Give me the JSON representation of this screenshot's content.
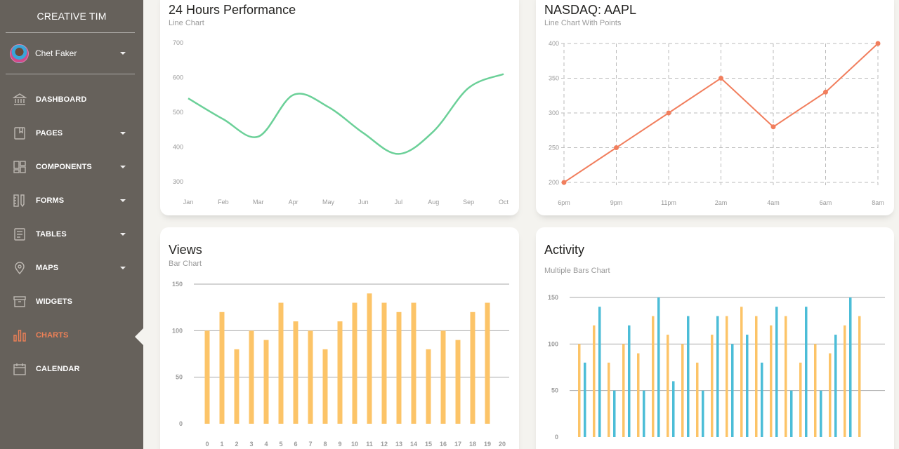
{
  "sidebar": {
    "brand": "CREATIVE TIM",
    "user_name": "Chet Faker",
    "items": [
      {
        "label": "DASHBOARD",
        "icon": "bank-icon",
        "has_caret": false,
        "active": false
      },
      {
        "label": "PAGES",
        "icon": "book-bookmark-icon",
        "has_caret": true,
        "active": false
      },
      {
        "label": "COMPONENTS",
        "icon": "layout-icon",
        "has_caret": true,
        "active": false
      },
      {
        "label": "FORMS",
        "icon": "ruler-pencil-icon",
        "has_caret": true,
        "active": false
      },
      {
        "label": "TABLES",
        "icon": "paper-icon",
        "has_caret": true,
        "active": false
      },
      {
        "label": "MAPS",
        "icon": "pin-icon",
        "has_caret": true,
        "active": false
      },
      {
        "label": "WIDGETS",
        "icon": "box-icon",
        "has_caret": false,
        "active": false
      },
      {
        "label": "CHARTS",
        "icon": "chart-bar-icon",
        "has_caret": false,
        "active": true
      },
      {
        "label": "CALENDAR",
        "icon": "calendar-icon",
        "has_caret": false,
        "active": false
      }
    ]
  },
  "colors": {
    "sidebar_bg": "#66615b",
    "accent": "#ef8157",
    "green": "#6bd098",
    "orange_line": "#f17e5d",
    "yellow": "#fcc468",
    "teal": "#4acccd",
    "blue": "#51bcda"
  },
  "cards": {
    "performance": {
      "title": "24 Hours Performance",
      "subtitle": "Line Chart"
    },
    "nasdaq": {
      "title": "NASDAQ: AAPL",
      "subtitle": "Line Chart With Points"
    },
    "views": {
      "title": "Views",
      "subtitle": "Bar Chart"
    },
    "activity": {
      "title": "Activity",
      "subtitle": "Multiple Bars Chart"
    }
  },
  "chart_data": [
    {
      "id": "performance",
      "type": "line",
      "title": "24 Hours Performance",
      "subtitle": "Line Chart",
      "categories": [
        "Jan",
        "Feb",
        "Mar",
        "Apr",
        "May",
        "Jun",
        "Jul",
        "Aug",
        "Sep",
        "Oct"
      ],
      "values": [
        540,
        480,
        430,
        550,
        515,
        440,
        380,
        445,
        570,
        610
      ],
      "yticks": [
        700,
        600,
        500,
        400,
        300
      ],
      "ylim": [
        300,
        700
      ],
      "grid": false,
      "color": "#6bd098"
    },
    {
      "id": "nasdaq",
      "type": "line",
      "title": "NASDAQ: AAPL",
      "subtitle": "Line Chart With Points",
      "categories": [
        "6pm",
        "9pm",
        "11pm",
        "2am",
        "4am",
        "6am",
        "8am"
      ],
      "values": [
        200,
        250,
        300,
        350,
        280,
        330,
        400
      ],
      "yticks": [
        400,
        350,
        300,
        250,
        200
      ],
      "ylim": [
        200,
        400
      ],
      "grid": true,
      "grid_style": "dashed",
      "color": "#f17e5d"
    },
    {
      "id": "views",
      "type": "bar",
      "title": "Views",
      "subtitle": "Bar Chart",
      "categories": [
        "0",
        "1",
        "2",
        "3",
        "4",
        "5",
        "6",
        "7",
        "8",
        "9",
        "10",
        "11",
        "12",
        "13",
        "14",
        "15",
        "16",
        "17",
        "18",
        "19",
        "20"
      ],
      "values": [
        100,
        120,
        80,
        100,
        90,
        130,
        110,
        100,
        80,
        110,
        130,
        140,
        130,
        120,
        130,
        80,
        100,
        90,
        120,
        130
      ],
      "yticks": [
        150,
        100,
        50,
        0
      ],
      "ylim": [
        0,
        150
      ],
      "grid": true,
      "color": "#fcc468"
    },
    {
      "id": "activity",
      "type": "bar",
      "title": "Activity",
      "subtitle": "Multiple Bars Chart",
      "yticks": [
        150,
        100,
        50,
        0
      ],
      "ylim": [
        0,
        150
      ],
      "grid": true,
      "series": [
        {
          "values": [
            100,
            120,
            80,
            100,
            90,
            130,
            110,
            100,
            80,
            110,
            130,
            140,
            130,
            120,
            130,
            80,
            100,
            90,
            120,
            130
          ],
          "color": "#fcc468"
        },
        {
          "values": [
            80,
            140,
            50,
            120,
            50,
            150,
            60,
            130,
            50,
            130,
            100,
            110,
            80,
            140,
            50,
            140,
            50,
            110,
            150
          ],
          "color": "#4cbdd7"
        }
      ]
    }
  ]
}
